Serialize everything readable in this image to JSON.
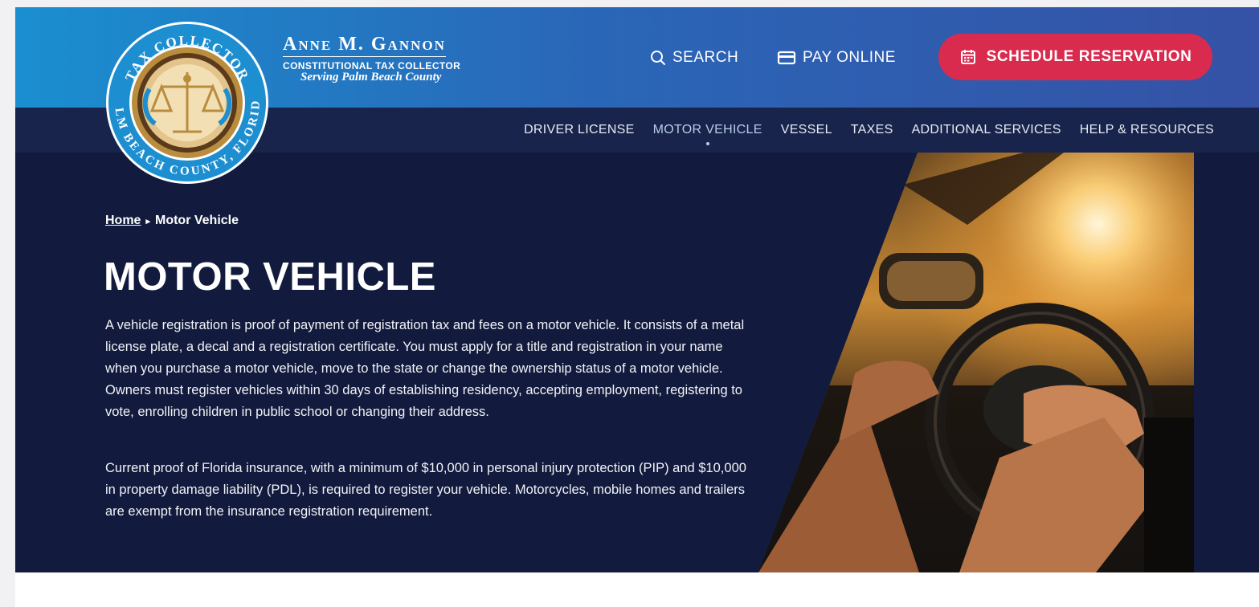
{
  "brand": {
    "name": "Anne M. Gannon",
    "subtitle": "CONSTITUTIONAL TAX COLLECTOR",
    "tagline": "Serving Palm Beach County"
  },
  "seal": {
    "top_text": "TAX COLLECTOR",
    "bottom_text": "PALM BEACH COUNTY, FLORIDA"
  },
  "top_links": {
    "search": "SEARCH",
    "pay_online": "PAY ONLINE",
    "schedule": "SCHEDULE RESERVATION"
  },
  "nav": {
    "items": [
      {
        "label": "DRIVER LICENSE"
      },
      {
        "label": "MOTOR VEHICLE"
      },
      {
        "label": "VESSEL"
      },
      {
        "label": "TAXES"
      },
      {
        "label": "ADDITIONAL SERVICES"
      },
      {
        "label": "HELP & RESOURCES"
      }
    ]
  },
  "breadcrumb": {
    "home": "Home",
    "current": "Motor Vehicle"
  },
  "hero": {
    "title": "MOTOR VEHICLE",
    "paragraph1": "A vehicle registration is proof of payment of registration tax and fees on a motor vehicle. It consists of a metal license plate, a decal and a registration certificate. You must apply for a title and registration in your name when you purchase a motor vehicle, move to the state or change the ownership status of a motor vehicle. Owners must register vehicles within 30 days of establishing residency, accepting employment, registering to vote, enrolling children in public school or changing their address.",
    "paragraph2": "Current proof of Florida insurance, with a minimum of $10,000 in personal injury protection (PIP) and $10,000 in property damage liability (PDL), is required to register your vehicle. Motorcycles, mobile homes and trailers are exempt from the insurance registration requirement."
  },
  "colors": {
    "topbar_start": "#1a8fd0",
    "topbar_end": "#3552a6",
    "nav_bg": "#18244b",
    "hero_bg": "#121b3d",
    "cta": "#d92b4e"
  },
  "icons": [
    "seal-logo",
    "search-icon",
    "card-icon",
    "calendar-icon",
    "breadcrumb-arrow-icon"
  ]
}
